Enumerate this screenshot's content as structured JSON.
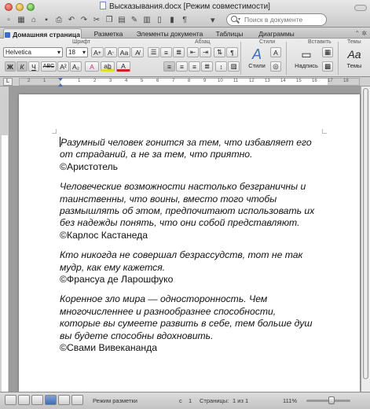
{
  "window": {
    "title": "Высказывания.docx [Режим совместимости]"
  },
  "search": {
    "placeholder": "Поиск в документе"
  },
  "ribbon_tabs": [
    {
      "label": "Домашняя страница",
      "active": true
    },
    {
      "label": "Разметка",
      "active": false
    },
    {
      "label": "Элементы документа",
      "active": false
    },
    {
      "label": "Таблицы",
      "active": false
    },
    {
      "label": "Диаграммы",
      "active": false
    }
  ],
  "groups": {
    "font": "Шрифт",
    "paragraph": "Абзац",
    "styles": "Стили",
    "insert": "Вставить",
    "themes": "Темы"
  },
  "font": {
    "family": "Helvetica",
    "size": "18"
  },
  "buttons": {
    "bold": "Ж",
    "italic": "К",
    "underline": "Ч",
    "strike": "ABC",
    "superscript": "A²",
    "subscript": "A₂",
    "styles_label": "Стили",
    "textbox_label": "Надпись",
    "themes_label": "Темы"
  },
  "document": {
    "quotes": [
      {
        "text": "Разумный человек гонится за тем, что избавляет его от страданий, а не за тем, что приятно.",
        "author": "©Аристотель"
      },
      {
        "text": "Человеческие возможности настолько безграничны и таинственны, что воины, вместо того чтобы размышлять об этом, предпочитают использовать их без надежды понять, что они собой представляют.",
        "author": "©Карлос Кастанеда"
      },
      {
        "text": "Кто никогда не совершал безрассудств, тот не так мудр, как ему кажется.",
        "author": "©Франсуа де Ларошфуко"
      },
      {
        "text": "Коренное зло мира — односторонность. Чем многочисленнее и разнообразнее способности, которые вы сумеете развить в себе, тем больше душ вы будете способны вдохновить.",
        "author": "©Свами Вивекананда"
      }
    ]
  },
  "status": {
    "view_mode": "Режим разметки",
    "section": "с",
    "section_num": "1",
    "pages_label": "Страницы:",
    "pages_value": "1 из 1",
    "zoom": "111%"
  },
  "colors": {
    "accent": "#3b6fc4",
    "page_bg": "#ffffff",
    "workspace_bg": "#9c9c9c"
  }
}
